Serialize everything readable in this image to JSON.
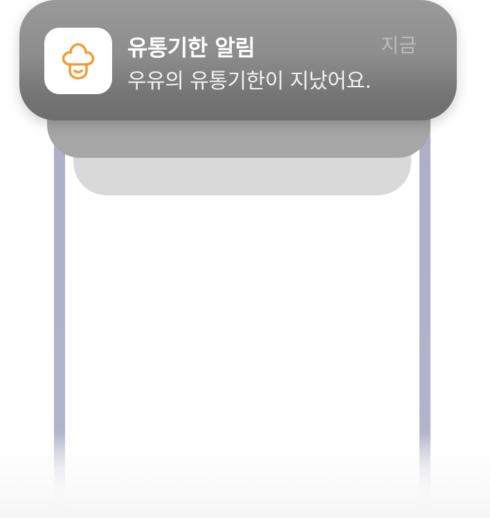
{
  "notification": {
    "app_icon": "chef-hat-icon",
    "title": "유통기한 알림",
    "time": "지금",
    "body": "우유의 유통기한이 지났어요."
  },
  "colors": {
    "icon_accent": "#F29B38",
    "notification_bg": "#8D8D8D",
    "frame_rail": "#B3B3CC"
  }
}
